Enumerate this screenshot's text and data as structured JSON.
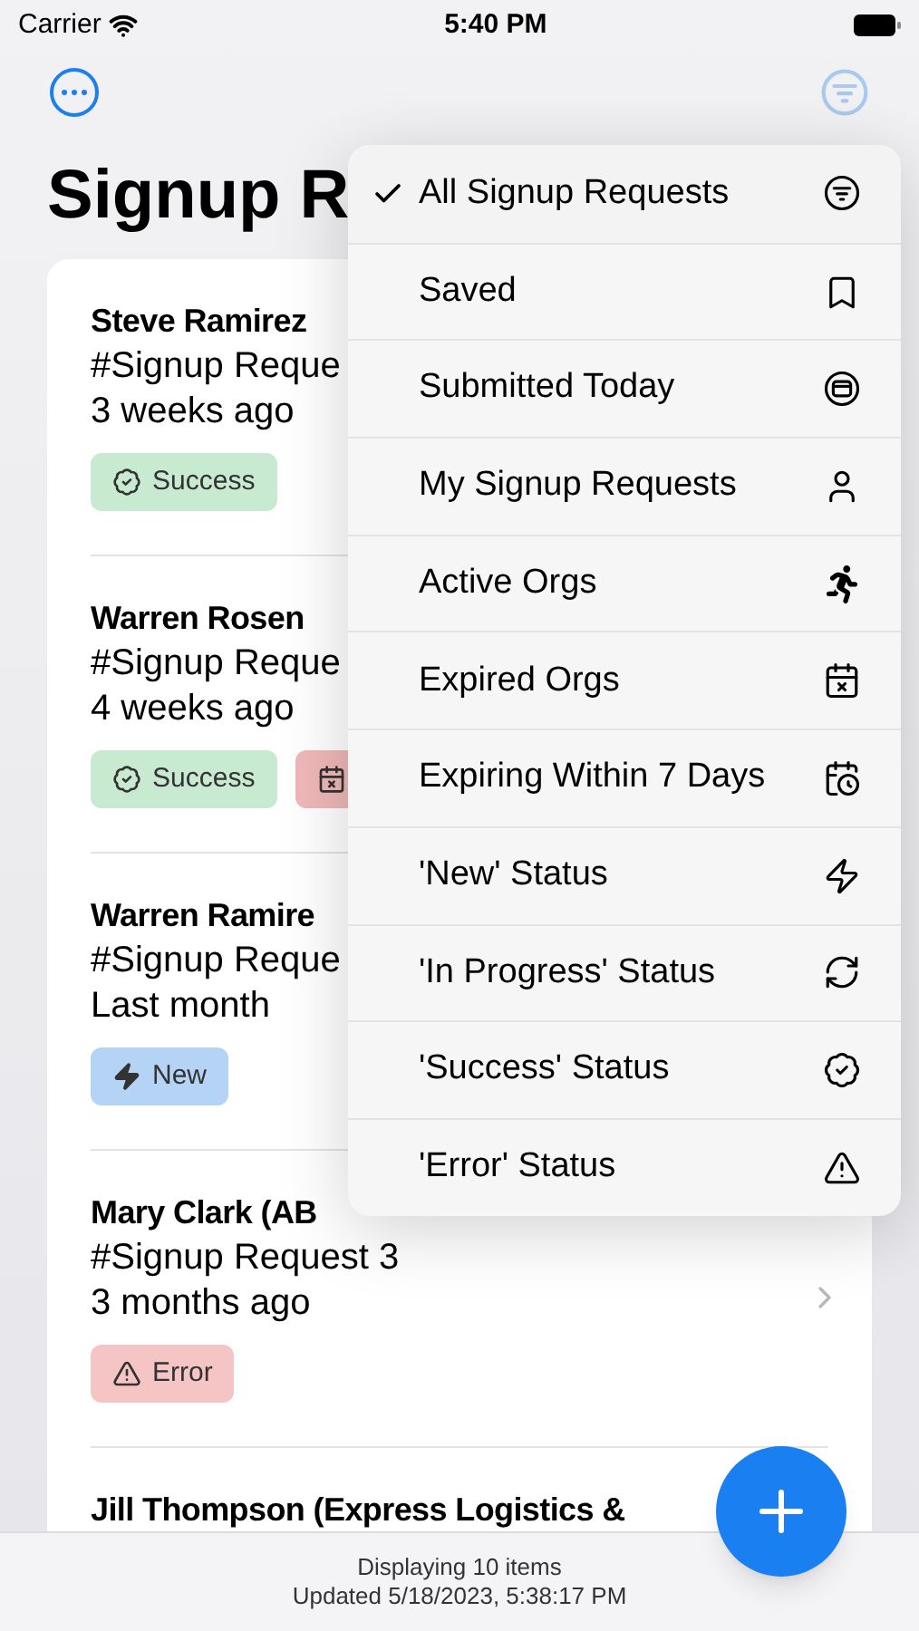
{
  "status_bar": {
    "carrier": "Carrier",
    "time": "5:40 PM"
  },
  "title": "Signup R",
  "rows": [
    {
      "name": "Steve Ramirez",
      "subtitle": "#Signup Reque",
      "time": "3 weeks ago",
      "chevron": false,
      "badges": [
        {
          "kind": "success",
          "label": "Success"
        }
      ]
    },
    {
      "name": "Warren Rosen",
      "subtitle": "#Signup Reque",
      "time": "4 weeks ago",
      "chevron": false,
      "badges": [
        {
          "kind": "success",
          "label": "Success"
        },
        {
          "kind": "expired"
        }
      ]
    },
    {
      "name": "Warren Ramire",
      "subtitle": "#Signup Reque",
      "time": "Last month",
      "chevron": false,
      "badges": [
        {
          "kind": "new",
          "label": "New"
        }
      ]
    },
    {
      "name": "Mary Clark (AB",
      "subtitle": "#Signup Request 3",
      "time": "3 months ago",
      "chevron": true,
      "badges": [
        {
          "kind": "error",
          "label": "Error"
        }
      ]
    },
    {
      "name": "Jill Thompson (Express Logistics &",
      "chevron": false,
      "badges": []
    }
  ],
  "menu": [
    {
      "label": "All Signup Requests",
      "selected": true
    },
    {
      "label": "Saved",
      "selected": false
    },
    {
      "label": "Submitted Today",
      "selected": false
    },
    {
      "label": "My Signup Requests",
      "selected": false
    },
    {
      "label": "Active Orgs",
      "selected": false
    },
    {
      "label": "Expired Orgs",
      "selected": false
    },
    {
      "label": "Expiring Within 7 Days",
      "selected": false
    },
    {
      "label": "'New' Status",
      "selected": false
    },
    {
      "label": "'In Progress' Status",
      "selected": false
    },
    {
      "label": "'Success' Status",
      "selected": false
    },
    {
      "label": "'Error' Status",
      "selected": false
    }
  ],
  "footer": {
    "count": "Displaying 10 items",
    "updated": "Updated 5/18/2023, 5:38:17 PM"
  }
}
